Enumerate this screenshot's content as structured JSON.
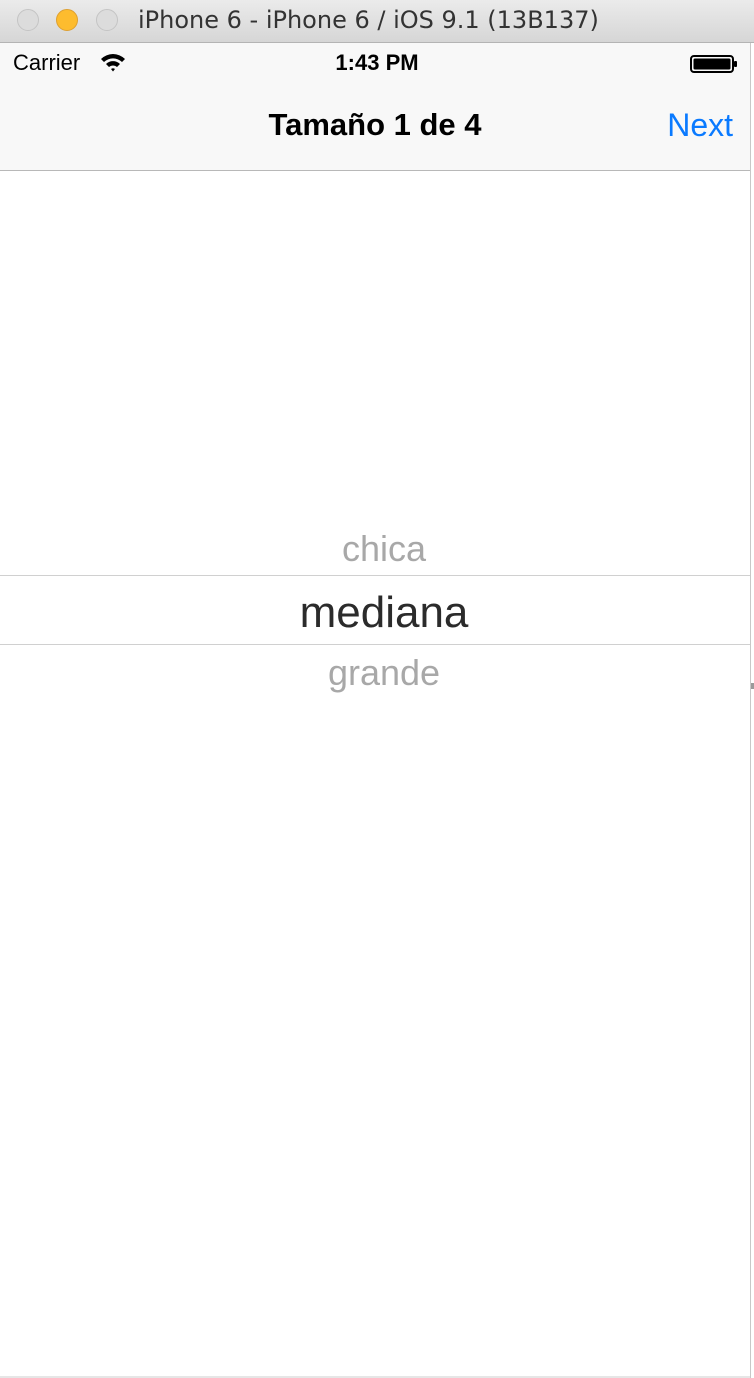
{
  "window": {
    "title": "iPhone 6 - iPhone 6 / iOS 9.1 (13B137)"
  },
  "status_bar": {
    "carrier": "Carrier",
    "time": "1:43 PM",
    "icons": [
      "wifi-icon",
      "battery-icon"
    ]
  },
  "nav_bar": {
    "title": "Tamaño 1 de 4",
    "next_label": "Next"
  },
  "picker": {
    "options": [
      "chica",
      "mediana",
      "grande"
    ],
    "selected": "mediana"
  },
  "colors": {
    "accent": "#0a7aff",
    "minimize_button": "#fdbc2e",
    "picker_selected_text": "#2b2b2b",
    "picker_faded_text": "#a8a8a8"
  }
}
